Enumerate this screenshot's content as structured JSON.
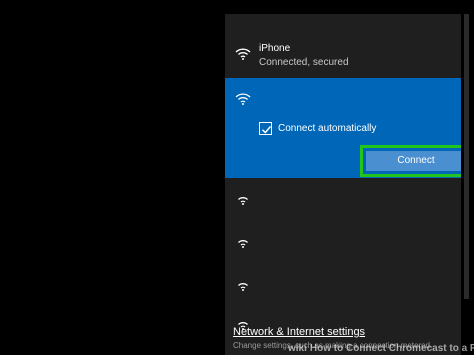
{
  "connected_network": {
    "name": "iPhone",
    "status": "Connected, secured",
    "icon": "wifi-icon"
  },
  "selected_network": {
    "icon": "wifi-icon",
    "connect_automatically_label": "Connect automatically",
    "connect_automatically_checked": true,
    "connect_button_label": "Connect",
    "highlight_color": "#22c51b",
    "accent_color": "#0067b8"
  },
  "other_networks": [
    {
      "icon": "wifi-icon"
    },
    {
      "icon": "wifi-icon"
    },
    {
      "icon": "wifi-icon"
    },
    {
      "icon": "wifi-icon"
    }
  ],
  "footer": {
    "settings_link": "Network & Internet settings",
    "settings_sub": "Change settings, such as making a connection metered."
  },
  "watermark": {
    "brand": "wiki",
    "title": "How to Connect Chromecast to a PC"
  }
}
